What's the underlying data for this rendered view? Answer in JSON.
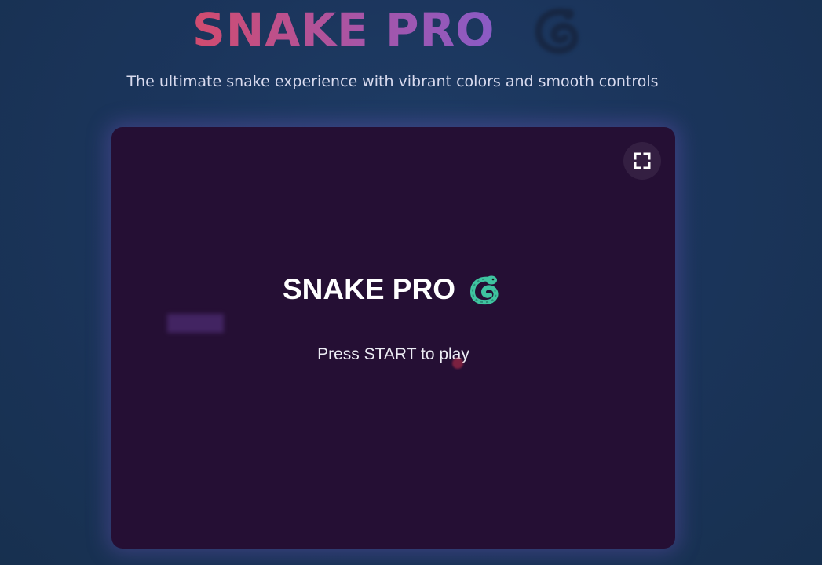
{
  "header": {
    "title": "SNAKE PRO",
    "title_icon": "snake-icon",
    "subtitle": "The ultimate snake experience with vibrant colors and smooth controls"
  },
  "board": {
    "title": "SNAKE PRO",
    "title_icon": "snake-icon",
    "prompt": "Press START to play",
    "fullscreen_icon": "expand-icon"
  },
  "colors": {
    "background": "#1b355c",
    "board_background": "#250f34",
    "title_gradient_start": "#d24b6e",
    "title_gradient_end": "#8a5bc5",
    "snake_icon": "#3fc4a0",
    "food": "#c2304b"
  }
}
